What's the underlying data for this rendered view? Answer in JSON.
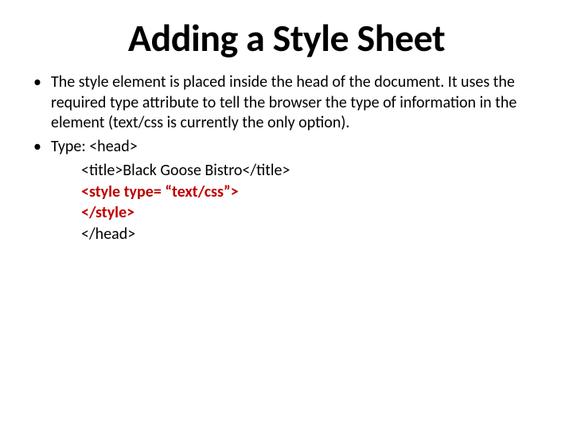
{
  "title": "Adding a Style Sheet",
  "bullets": [
    "The style element is placed inside the head of the document. It uses the required type attribute to tell the browser the type of information in the element (text/css is currently the only option).",
    "Type: <head>"
  ],
  "code": {
    "line1": "<title>Black Goose Bistro</title>",
    "line2": "<style type= “text/css”>",
    "line3": "</style>",
    "line4": "</head>"
  }
}
